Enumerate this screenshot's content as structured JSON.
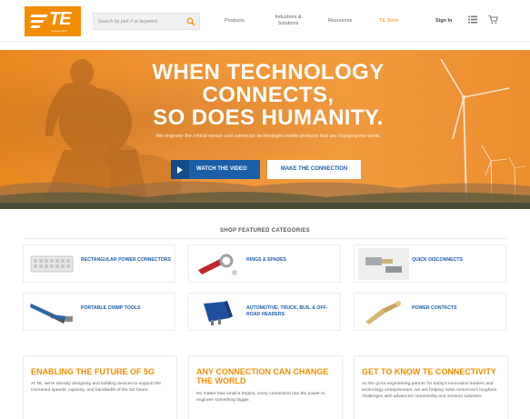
{
  "header": {
    "logo": {
      "text": "TE",
      "tagline": "connectivity"
    },
    "search": {
      "placeholder": "Search by part # or keyword"
    },
    "nav": {
      "products": "Products",
      "industries_line1": "Industries &",
      "industries_line2": "Solutions",
      "resources": "Resources",
      "store": "TE Store",
      "signin": "Sign In"
    },
    "icons": {
      "search": "search-icon",
      "list": "list-icon",
      "cart": "cart-icon"
    }
  },
  "hero": {
    "title_line1": "WHEN TECHNOLOGY",
    "title_line2": "CONNECTS,",
    "title_line3": "SO DOES HUMANITY.",
    "subtitle": "We engineer the critical sensor and connector technologies inside products that are changing the world.",
    "video_button": "WATCH THE VIDEO",
    "connect_button": "MAKE THE CONNECTION"
  },
  "featured": {
    "title": "SHOP FEATURED CATEGORIES",
    "categories": [
      {
        "label": "RECTANGULAR POWER CONNECTORS"
      },
      {
        "label": "RINGS & SPADES"
      },
      {
        "label": "QUICK DISCONNECTS"
      },
      {
        "label": "PORTABLE CRIMP TOOLS"
      },
      {
        "label": "AUTOMOTIVE, TRUCK, BUS, & OFF-ROAD HEADERS"
      },
      {
        "label": "POWER CONTACTS"
      }
    ]
  },
  "cards": [
    {
      "title": "ENABLING THE FUTURE OF 5G",
      "body": "At TE, we're already designing and building devices to support the increased speeds, capacity, and bandwidth of the 5G future."
    },
    {
      "title": "ANY CONNECTION CAN CHANGE THE WORLD",
      "body": "No matter how small it begins, every connection has the power to engineer something bigger."
    },
    {
      "title": "GET TO KNOW TE CONNECTIVITY",
      "body": "As the go-to engineering partner for today's innovation leaders and technology entrepreneurs, we are helping solve tomorrow's toughest challenges with advanced connectivity and sensors solutions."
    }
  ],
  "colors": {
    "brand_orange": "#f28d00",
    "link_blue": "#1c5ea8",
    "hero_orange": "#f09436"
  }
}
